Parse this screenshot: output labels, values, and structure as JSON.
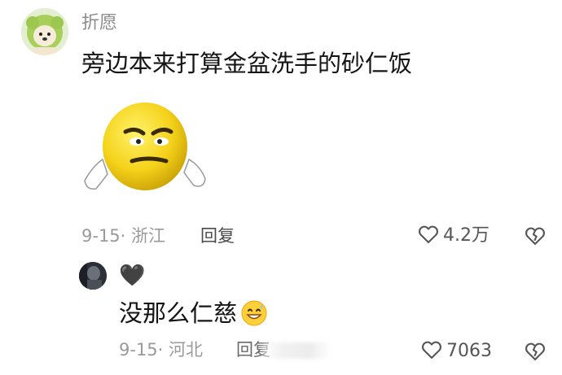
{
  "comment": {
    "username": "折愿",
    "text": "旁边本来打算金盆洗手的砂仁饭",
    "date_location": "9-15· 浙江",
    "reply_label": "回复",
    "like_count": "4.2万",
    "sticker_icon": "angry-emoji-sticker"
  },
  "reply": {
    "username": "🖤",
    "text": "没那么仁慈",
    "emoji_icon": "grinning-sweat-emoji",
    "date_location": "9-15· 河北",
    "reply_label": "回复",
    "like_count": "7063"
  },
  "colors": {
    "meta_gray": "#9a9a9a",
    "text_dark": "#151515",
    "emoji_yellow": "#f5d21a"
  }
}
